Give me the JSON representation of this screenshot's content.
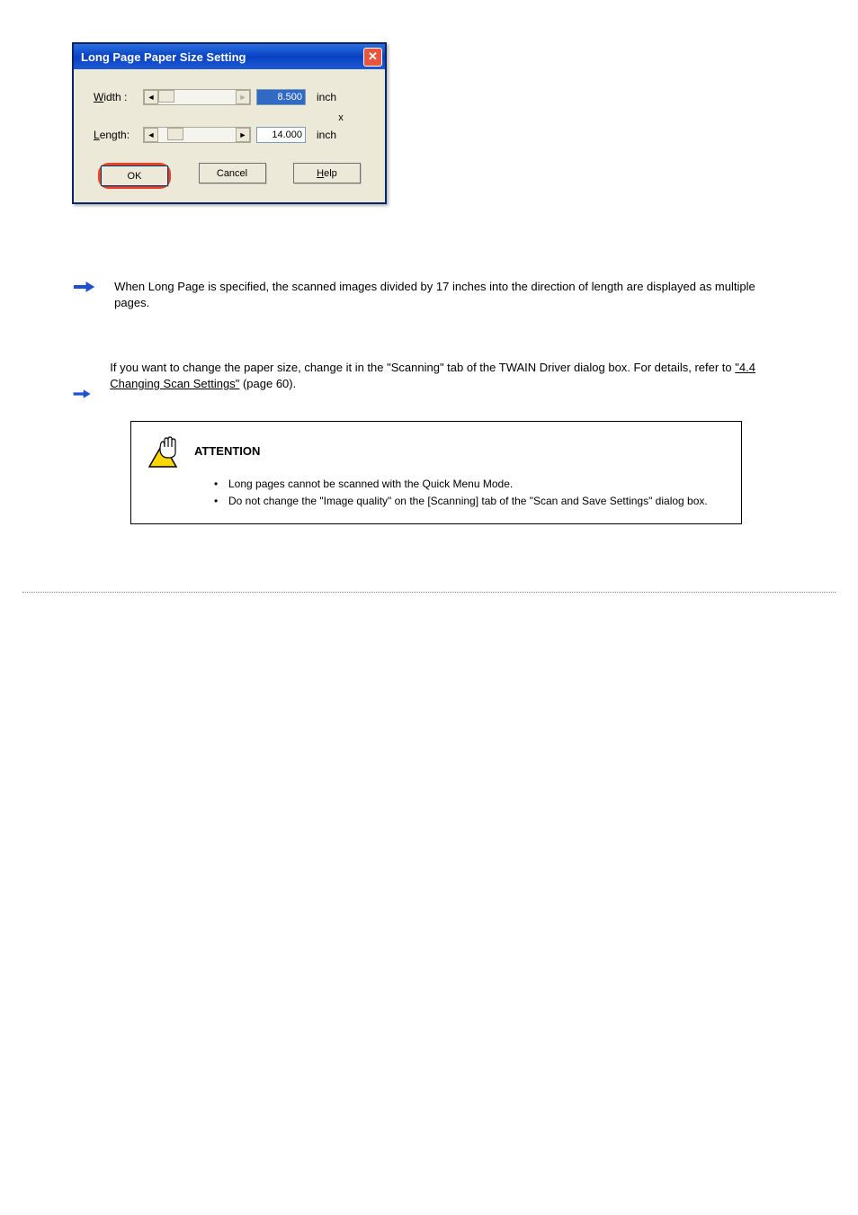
{
  "dialog": {
    "title": "Long Page Paper Size Setting",
    "width_label_u": "W",
    "width_label_rest": "idth :",
    "width_value": "8.500",
    "width_unit": "inch",
    "separator": "x",
    "length_label_u": "L",
    "length_label_rest": "ength:",
    "length_value": "14.000",
    "length_unit": "inch",
    "ok_label": "OK",
    "cancel_label": "Cancel",
    "help_label_u": "H",
    "help_label_rest": "elp"
  },
  "bullets": {
    "b1": "When Long Page is specified, the scanned images divided by 17 inches into the direction of length are displayed as multiple pages.",
    "b2": "If you want to change the paper size, change it in the \"Scanning\" tab of the TWAIN Driver dialog box. For details, refer to ",
    "b2_link": "\"4.4 Changing Scan Settings\"",
    "b2_page": " (page 60)",
    "b2_period": "."
  },
  "attention": {
    "title": "ATTENTION",
    "items": [
      "Long pages cannot be scanned with the Quick Menu Mode.",
      "Do not change the \"Image quality\" on the [Scanning] tab of the \"Scan and Save Settings\" dialog box."
    ]
  }
}
